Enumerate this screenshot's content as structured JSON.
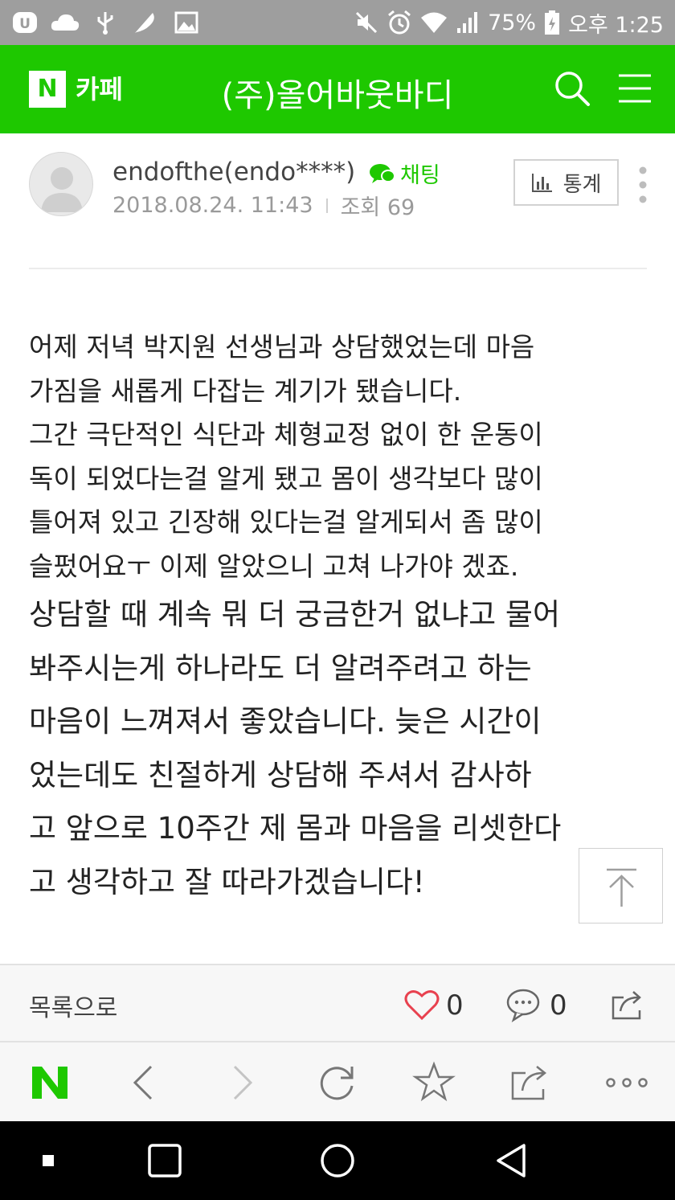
{
  "status_bar": {
    "battery": "75%",
    "time": "오후 1:25",
    "icons_left": [
      "uplus-icon",
      "cloud-icon",
      "usb-icon",
      "feather-icon",
      "image-icon"
    ],
    "icons_right": [
      "mute-icon",
      "alarm-icon",
      "wifi-icon",
      "signal-icon",
      "battery-icon"
    ]
  },
  "header": {
    "logo": "N",
    "service": "카페",
    "title": "(주)올어바웃바디"
  },
  "post": {
    "author": "endofthe(endo****)",
    "chat_label": "채팅",
    "date": "2018.08.24. 11:43",
    "views": "조회 69",
    "stats_label": "통계",
    "body_small": [
      "어제 저녁 박지원 선생님과 상담했었는데 마음",
      "가짐을 새롭게 다잡는 계기가 됐습니다.",
      "그간 극단적인 식단과 체형교정 없이 한 운동이",
      "독이 되었다는걸 알게 됐고 몸이 생각보다 많이",
      "틀어져 있고 긴장해 있다는걸 알게되서 좀 많이",
      "슬펐어요ㅜ 이제 알았으니 고쳐 나가야 겠죠."
    ],
    "body_large": [
      "상담할 때 계속 뭐 더 궁금한거 없냐고 물어",
      "봐주시는게 하나라도 더 알려주려고 하는",
      "마음이 느껴져서 좋았습니다. 늦은 시간이",
      "었는데도 친절하게 상담해 주셔서 감사하",
      "고 앞으로 10주간 제 몸과 마음을 리셋한다",
      "고 생각하고 잘 따라가겠습니다!"
    ]
  },
  "footer": {
    "back_label": "목록으로",
    "likes": "0",
    "comments": "0"
  },
  "colors": {
    "brand_green": "#1ec800",
    "status_bar": "#9e9e9e",
    "like_red": "#e8414f"
  }
}
